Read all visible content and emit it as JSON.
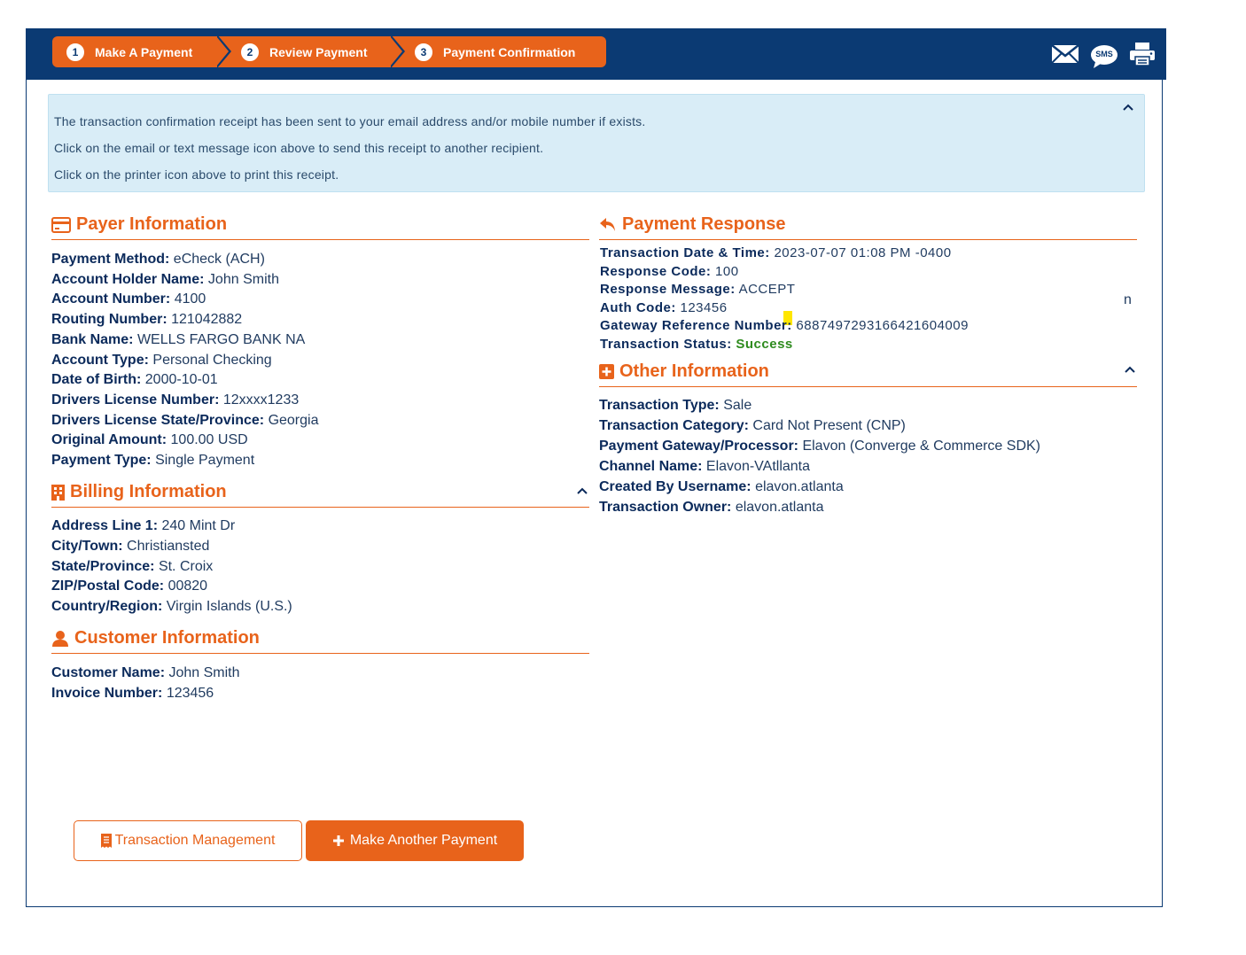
{
  "wizard": {
    "steps": [
      {
        "num": "1",
        "label": "Make A Payment"
      },
      {
        "num": "2",
        "label": "Review Payment"
      },
      {
        "num": "3",
        "label": "Payment Confirmation"
      }
    ]
  },
  "toolbar": {
    "icons": [
      "email-icon",
      "sms-icon",
      "printer-icon"
    ],
    "sms_label": "SMS"
  },
  "alert": {
    "lines": [
      "The transaction confirmation receipt has been sent to your email address and/or mobile number if exists.",
      "Click on the email or text message icon above to send this receipt to another recipient.",
      "Click on the printer icon above to print this receipt."
    ]
  },
  "payer": {
    "title": "Payer Information",
    "fields": [
      {
        "label": "Payment Method:",
        "value": "eCheck (ACH)"
      },
      {
        "label": "Account Holder Name:",
        "value": "John Smith"
      },
      {
        "label": "Account Number:",
        "value": "4100"
      },
      {
        "label": "Routing Number:",
        "value": "121042882"
      },
      {
        "label": "Bank Name:",
        "value": "WELLS FARGO BANK NA"
      },
      {
        "label": "Account Type:",
        "value": "Personal Checking"
      },
      {
        "label": "Date of Birth:",
        "value": "2000-10-01"
      },
      {
        "label": "Drivers License Number:",
        "value": "12xxxx1233"
      },
      {
        "label": "Drivers License State/Province:",
        "value": "Georgia"
      },
      {
        "label": "Original Amount:",
        "value": "100.00 USD"
      },
      {
        "label": "Payment Type:",
        "value": "Single Payment"
      }
    ]
  },
  "billing": {
    "title": "Billing Information",
    "fields": [
      {
        "label": "Address Line 1:",
        "value": "240 Mint Dr"
      },
      {
        "label": "City/Town:",
        "value": "Christiansted"
      },
      {
        "label": "State/Province:",
        "value": "St. Croix"
      },
      {
        "label": "ZIP/Postal Code:",
        "value": "00820"
      },
      {
        "label": "Country/Region:",
        "value": "Virgin Islands (U.S.)"
      }
    ]
  },
  "customer": {
    "title": "Customer Information",
    "fields": [
      {
        "label": "Customer Name:",
        "value": "John Smith"
      },
      {
        "label": "Invoice Number:",
        "value": "123456"
      }
    ]
  },
  "response": {
    "title": "Payment Response",
    "fields": [
      {
        "label": "Transaction Date & Time:",
        "value": "2023-07-07 01:08 PM -0400"
      },
      {
        "label": "Response Code:",
        "value": "100"
      },
      {
        "label": "Response Message:",
        "value": "ACCEPT"
      },
      {
        "label": "Auth Code:",
        "value": "123456"
      },
      {
        "label": "Gateway Reference Number:",
        "value": "6887497293166421604009"
      },
      {
        "label": "Transaction Status:",
        "value": "Success"
      }
    ],
    "stray_char": "n",
    "success_color": "#2e8b1e"
  },
  "other": {
    "title": "Other Information",
    "fields": [
      {
        "label": "Transaction Type:",
        "value": "Sale"
      },
      {
        "label": "Transaction Category:",
        "value": "Card Not Present (CNP)"
      },
      {
        "label": "Payment Gateway/Processor:",
        "value": "Elavon (Converge & Commerce SDK)"
      },
      {
        "label": "Channel Name:",
        "value": "Elavon-VAtllanta"
      },
      {
        "label": "Created By Username:",
        "value": "elavon.atlanta"
      },
      {
        "label": "Transaction Owner:",
        "value": "elavon.atlanta"
      }
    ]
  },
  "actions": {
    "transaction_management": "Transaction Management",
    "make_another_payment": "Make Another Payment"
  },
  "colors": {
    "brand_navy": "#0b3a73",
    "accent_orange": "#e8631b",
    "alert_bg": "#d9edf7"
  }
}
